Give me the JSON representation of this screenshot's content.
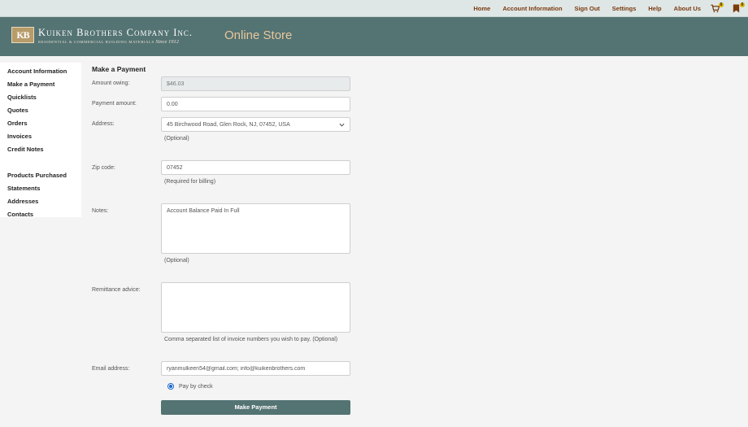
{
  "topnav": {
    "links": [
      "Home",
      "Account Information",
      "Sign Out",
      "Settings",
      "Help",
      "About Us"
    ],
    "cart_count": "0",
    "flag_count": "0",
    "cart_icon": "cart-icon",
    "flag_icon": "bookmark-icon"
  },
  "header": {
    "logo_mark": "KB",
    "company_name": "Kuiken Brothers Company Inc.",
    "company_tagline": "Residential & Commercial Building Materials",
    "company_since": "Since 1912",
    "store_title": "Online Store"
  },
  "sidebar": {
    "items": [
      "Account Information",
      "Make a Payment",
      "Quicklists",
      "Quotes",
      "Orders",
      "Invoices",
      "Credit Notes"
    ],
    "items2": [
      "Products Purchased",
      "Statements",
      "Addresses",
      "Contacts"
    ]
  },
  "form": {
    "title": "Make a Payment",
    "amount_owing_label": "Amount owing:",
    "amount_owing_value": "$46.03",
    "payment_amount_label": "Payment amount:",
    "payment_amount_value": "0.00",
    "address_label": "Address:",
    "address_value": "45 Birchwood Road, Glen Rock, NJ, 07452, USA",
    "address_hint": "(Optional)",
    "zip_label": "Zip code:",
    "zip_value": "07452",
    "zip_hint": "(Required for billing)",
    "notes_label": "Notes:",
    "notes_value": "Account Balance Paid In Full",
    "notes_hint": "(Optional)",
    "remittance_label": "Remittance advice:",
    "remittance_value": "",
    "remittance_hint": "Comma separated list of invoice numbers you wish to pay. (Optional)",
    "email_label": "Email address:",
    "email_value": "ryanmulkeen54@gmail.com; info@kuikenbrothers.com",
    "pay_option_label": "Pay by check",
    "submit_label": "Make Payment"
  },
  "colors": {
    "header_bg": "#547373",
    "topnav_link": "#7a3b0e",
    "store_title": "#e8c79b",
    "button_bg": "#547373"
  }
}
